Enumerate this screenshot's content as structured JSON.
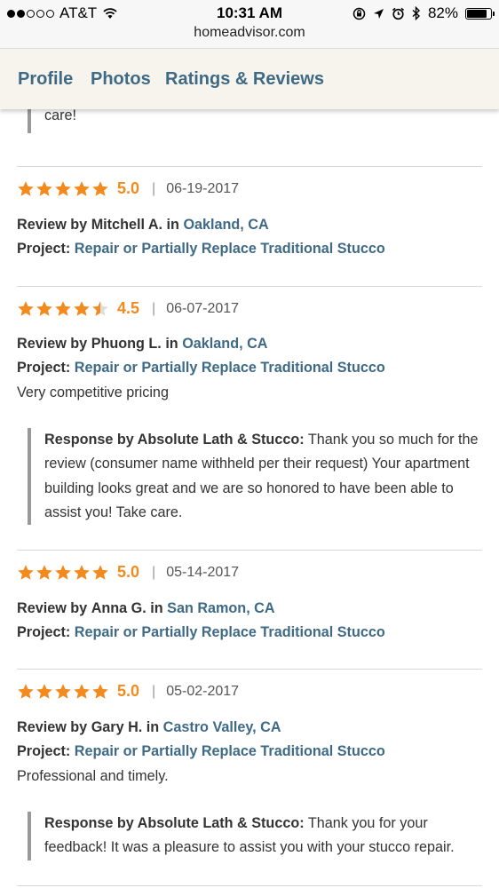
{
  "status": {
    "carrier": "AT&T",
    "time": "10:31 AM",
    "battery": "82%",
    "url": "homeadvisor.com"
  },
  "tabs": [
    "Profile",
    "Photos",
    "Ratings & Reviews"
  ],
  "top_response_tail": "care!",
  "labels": {
    "review_by": "Review by",
    "in": "in",
    "project": "Project:",
    "response_by": "Response by Absolute Lath & Stucco:"
  },
  "reviews": [
    {
      "rating": 5.0,
      "score": "5.0",
      "date": "06-19-2017",
      "reviewer": "Mitchell A.",
      "location": "Oakland, CA",
      "project": "Repair or Partially Replace Traditional Stucco",
      "comment": "",
      "response": ""
    },
    {
      "rating": 4.5,
      "score": "4.5",
      "date": "06-07-2017",
      "reviewer": "Phuong L.",
      "location": "Oakland, CA",
      "project": "Repair or Partially Replace Traditional Stucco",
      "comment": "Very competitive pricing",
      "response": "Thank you so much for the review (consumer name withheld per their request) Your apartment building looks great and we are so honored to have been able to assist you! Take care."
    },
    {
      "rating": 5.0,
      "score": "5.0",
      "date": "05-14-2017",
      "reviewer": "Anna G.",
      "location": "San Ramon, CA",
      "project": "Repair or Partially Replace Traditional Stucco",
      "comment": "",
      "response": ""
    },
    {
      "rating": 5.0,
      "score": "5.0",
      "date": "05-02-2017",
      "reviewer": "Gary H.",
      "location": "Castro Valley, CA",
      "project": "Repair or Partially Replace Traditional Stucco",
      "comment": "Professional and timely.",
      "response": "Thank you for your feedback! It was a pleasure to assist you with your stucco repair."
    }
  ],
  "colors": {
    "accent": "#3e6a86",
    "star": "#f28a1d",
    "tabbar_bg": "#f6f4ed"
  }
}
